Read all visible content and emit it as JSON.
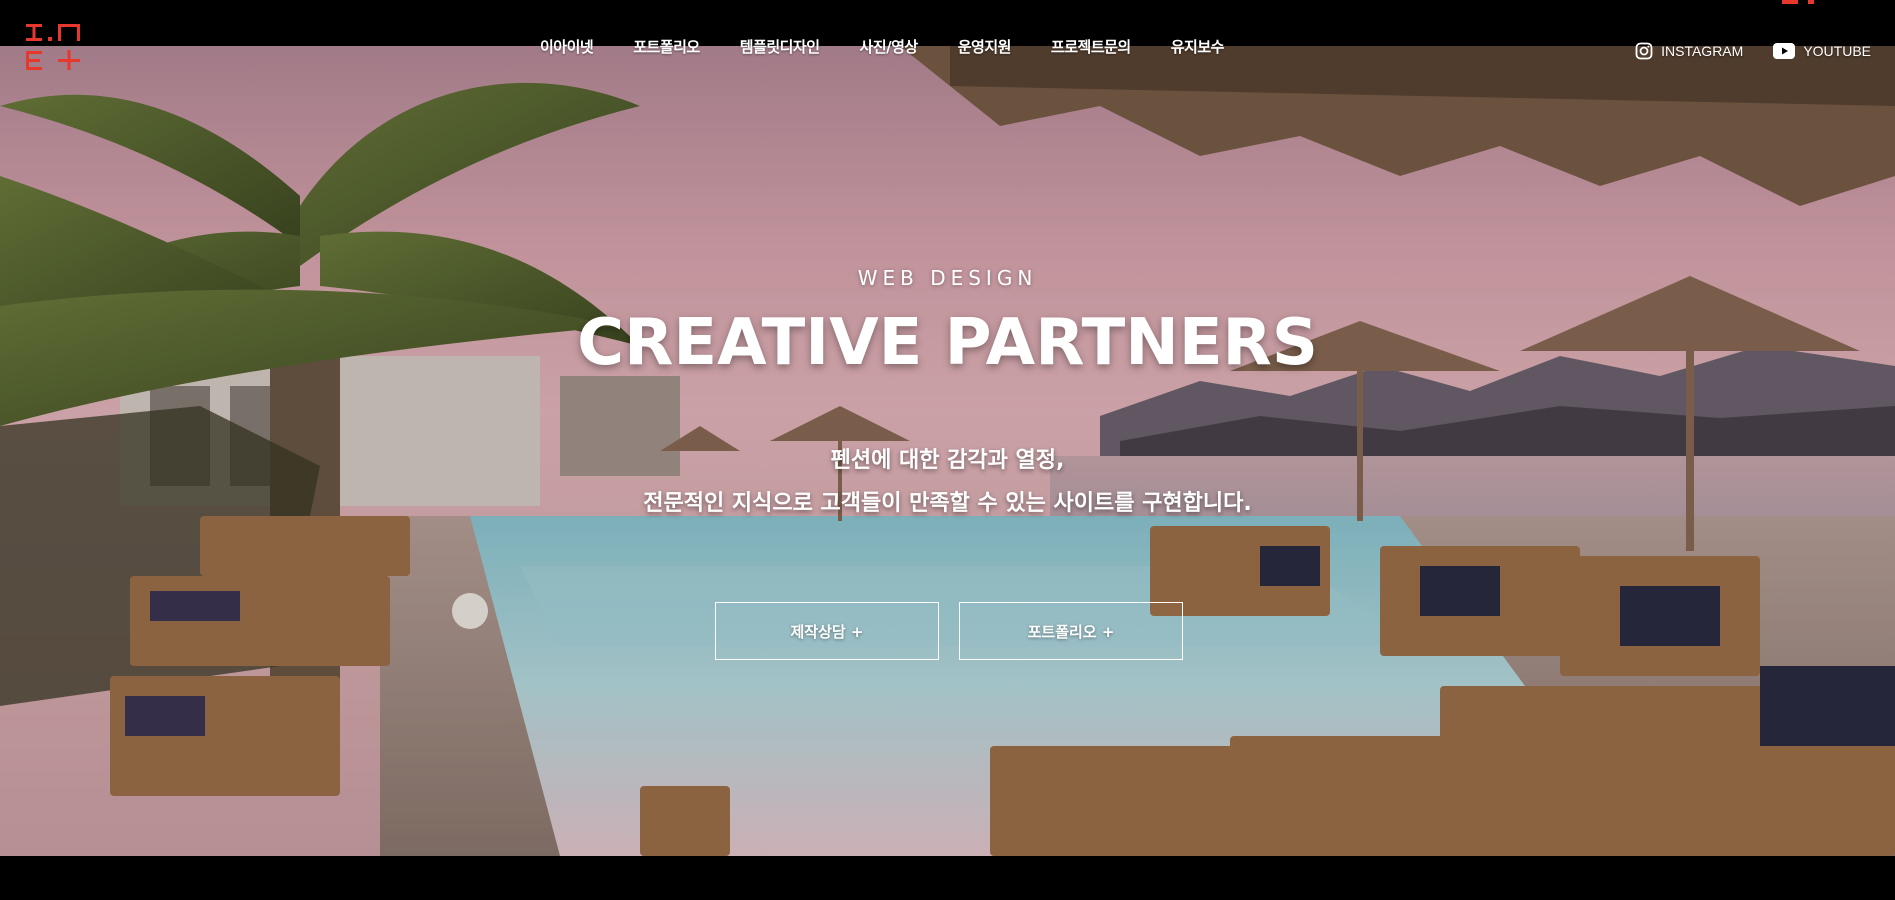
{
  "brand": {
    "logo_name": "ine-logo",
    "accent_color": "#e8372c"
  },
  "nav": {
    "items": [
      {
        "label": "이아이넷"
      },
      {
        "label": "포트폴리오"
      },
      {
        "label": "템플릿디자인"
      },
      {
        "label": "사진/영상"
      },
      {
        "label": "운영지원"
      },
      {
        "label": "프로젝트문의"
      },
      {
        "label": "유지보수"
      }
    ]
  },
  "social": {
    "instagram": {
      "label": "INSTAGRAM",
      "icon": "instagram-icon"
    },
    "youtube": {
      "label": "YOUTUBE",
      "icon": "youtube-icon"
    }
  },
  "hero": {
    "eyebrow": "WEB DESIGN",
    "headline": "CREATIVE PARTNERS",
    "sub_line1": "펜션에 대한 감각과 열정,",
    "sub_line2": "전문적인 지식으로 고객들이 만족할 수 있는 사이트를 구현합니다.",
    "buttons": {
      "consult": "제작상담 +",
      "portfolio": "포트폴리오 +"
    },
    "background_scene": "resort pool with palm trees and thatched umbrellas at dusk"
  }
}
